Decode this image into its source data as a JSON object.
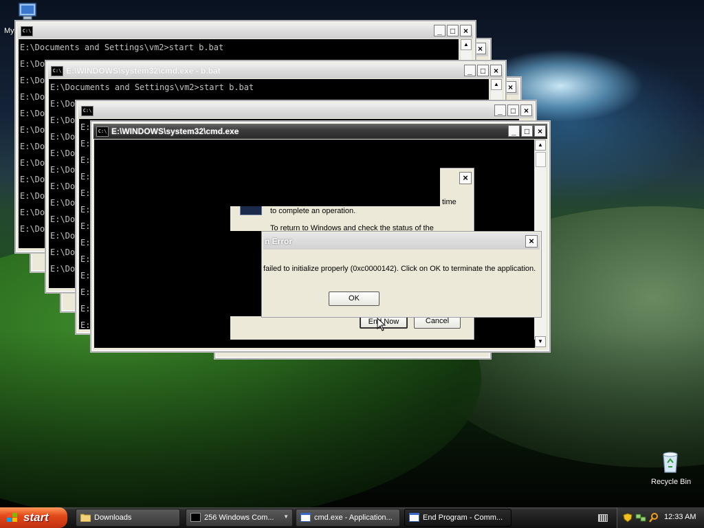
{
  "desktop": {
    "icons": [
      {
        "label": "My"
      },
      {
        "label": "Recycle Bin"
      }
    ]
  },
  "windows": {
    "w1": {
      "title": "",
      "lines": [
        "E:\\Documents and Settings\\vm2>start b.bat",
        "E:\\Do",
        "E:\\Do",
        "E:\\Do",
        "E:\\Do",
        "E:\\Do",
        "E:\\Do",
        "E:\\Do",
        "E:\\Do",
        "E:\\Do",
        "E:\\Do",
        "E:\\Do"
      ]
    },
    "w2": {
      "title": "E:\\WINDOWS\\system32\\cmd.exe - b.bat",
      "lines": [
        "E:\\Documents and Settings\\vm2>start b.bat",
        "E:\\Do",
        "E:\\Do",
        "E:\\Do",
        "E:\\Do",
        "E:\\Do",
        "E:\\Do",
        "E:\\Do",
        "E:\\Do",
        "E:\\Do",
        "E:\\Do",
        "E:\\Do"
      ]
    },
    "w3": {
      "title": "",
      "lines": [
        "E:",
        "E:",
        "E:",
        "E:",
        "E:",
        "E:",
        "E:",
        "E:",
        "E:",
        "E:",
        "E:",
        "E:",
        "E:"
      ]
    },
    "w4": {
      "title": "E:\\WINDOWS\\system32\\cmd.exe"
    }
  },
  "buttons": {
    "minimize": "_",
    "maximize": "□",
    "close": "×"
  },
  "end_program": {
    "line1_tail": "time",
    "line2": "to complete an operation.",
    "line3": "To return to Windows and check the status of the",
    "end_now_label": "End Now",
    "cancel_label": "Cancel"
  },
  "app_error": {
    "title_fragment": "n Error",
    "message": "failed to initialize properly (0xc0000142). Click on OK to terminate the application.",
    "ok_label": "OK"
  },
  "taskbar": {
    "start_label": "start",
    "tasks": [
      {
        "label": "Downloads"
      },
      {
        "label": "256 Windows Com..."
      },
      {
        "label": "cmd.exe - Application..."
      },
      {
        "label": "End Program - Comm..."
      }
    ],
    "clock": "12:33 AM"
  }
}
